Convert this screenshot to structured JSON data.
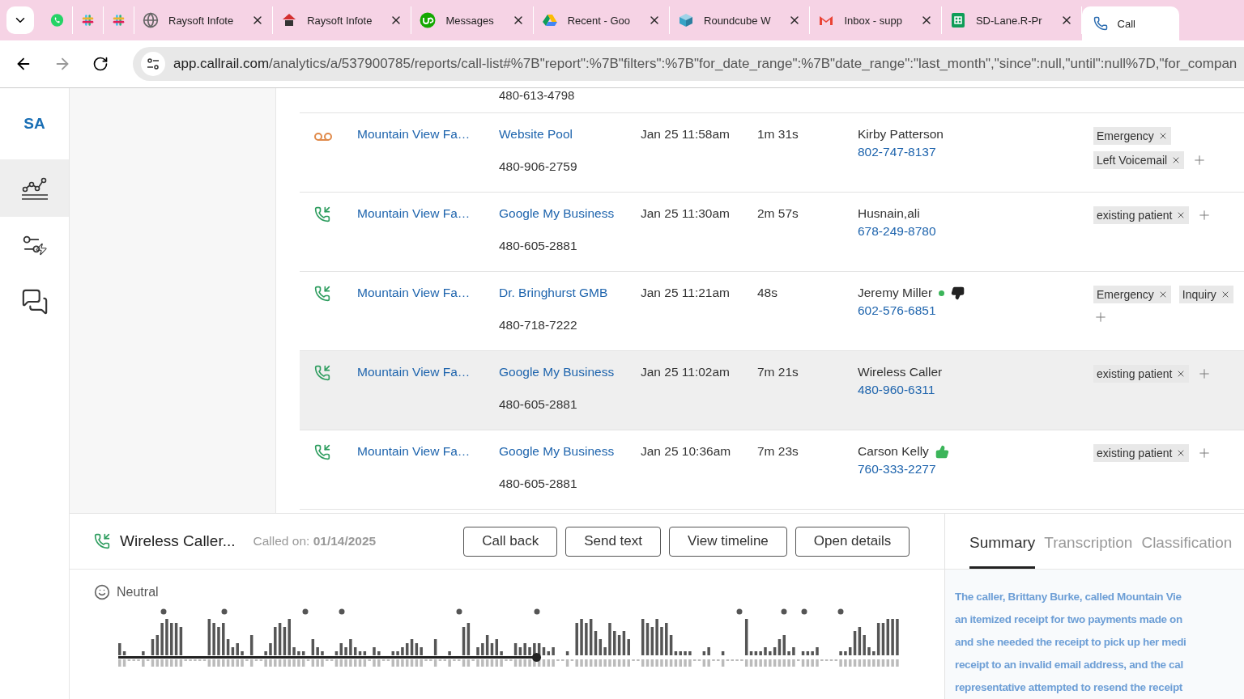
{
  "browser": {
    "tabs": [
      {
        "kind": "whatsapp",
        "selected": false
      },
      {
        "kind": "slack",
        "selected": false
      },
      {
        "kind": "slack",
        "selected": false
      },
      {
        "kind": "globe",
        "title": "Raysoft Infote",
        "selected": false
      },
      {
        "kind": "raysoft",
        "title": "Raysoft Infote",
        "selected": false
      },
      {
        "kind": "upwork",
        "title": "Messages",
        "selected": false
      },
      {
        "kind": "drive",
        "title": "Recent - Goo",
        "selected": false
      },
      {
        "kind": "roundcube",
        "title": "Roundcube W",
        "selected": false
      },
      {
        "kind": "gmail",
        "title": "Inbox - supp",
        "selected": false
      },
      {
        "kind": "sheets",
        "title": "SD-Lane.R-Pr",
        "selected": false
      },
      {
        "kind": "phone",
        "title": "Call",
        "selected": true
      }
    ],
    "url_domain": "app.callrail.com",
    "url_path": "/analytics/a/537900785/reports/call-list#%7B\"report\":%7B\"filters\":%7B\"for_date_range\":%7B\"date_range\":\"last_month\",\"since\":null,\"until\":null%7D,\"for_compan"
  },
  "sidebar": {
    "avatar": "SA",
    "items": [
      {
        "kind": "analytics",
        "selected": true
      },
      {
        "kind": "settings",
        "selected": false
      },
      {
        "kind": "messages",
        "selected": false
      }
    ]
  },
  "partial_row": {
    "number": "480-613-4798"
  },
  "rows": [
    {
      "kind": "voicemail",
      "company": "Mountain View Fa…",
      "source": "Website Pool",
      "number": "480-906-2759",
      "date": "Jan 25 11:58am",
      "duration": "1m 31s",
      "caller": "Kirby Patterson",
      "caller_phone": "802-747-8137",
      "dot": false,
      "thumbs_up": false,
      "thumbs_down": false,
      "selected": false,
      "tags": [
        "Emergency",
        "Left Voicemail"
      ]
    },
    {
      "kind": "inbound",
      "company": "Mountain View Fa…",
      "source": "Google My Business",
      "number": "480-605-2881",
      "date": "Jan 25 11:30am",
      "duration": "2m 57s",
      "caller": "Husnain,ali",
      "caller_phone": "678-249-8780",
      "dot": false,
      "thumbs_up": false,
      "thumbs_down": false,
      "selected": false,
      "tags": [
        "existing patient"
      ]
    },
    {
      "kind": "inbound",
      "company": "Mountain View Fa…",
      "source": "Dr. Bringhurst GMB",
      "number": "480-718-7222",
      "date": "Jan 25 11:21am",
      "duration": "48s",
      "caller": "Jeremy Miller",
      "caller_phone": "602-576-6851",
      "dot": true,
      "thumbs_up": false,
      "thumbs_down": true,
      "selected": false,
      "tags": [
        "Emergency",
        "Inquiry"
      ]
    },
    {
      "kind": "inbound",
      "company": "Mountain View Fa…",
      "source": "Google My Business",
      "number": "480-605-2881",
      "date": "Jan 25 11:02am",
      "duration": "7m 21s",
      "caller": "Wireless Caller",
      "caller_phone": "480-960-6311",
      "dot": false,
      "thumbs_up": false,
      "thumbs_down": false,
      "selected": true,
      "tags": [
        "existing patient"
      ]
    },
    {
      "kind": "inbound",
      "company": "Mountain View Fa…",
      "source": "Google My Business",
      "number": "480-605-2881",
      "date": "Jan 25 10:36am",
      "duration": "7m 23s",
      "caller": "Carson Kelly",
      "caller_phone": "760-333-2277",
      "dot": false,
      "thumbs_up": true,
      "thumbs_down": false,
      "selected": false,
      "tags": [
        "existing patient"
      ]
    }
  ],
  "detail": {
    "caller": "Wireless Caller...",
    "called_on_label": "Called on:",
    "called_on": "01/14/2025",
    "buttons": [
      "Call back",
      "Send text",
      "View timeline",
      "Open details"
    ],
    "sentiment": "Neutral",
    "playback": {
      "level": 0.535
    },
    "tabs": [
      {
        "label": "Summary",
        "selected": true
      },
      {
        "label": "Transcription",
        "selected": false
      },
      {
        "label": "Classification",
        "selected": false
      }
    ],
    "summary_lines": [
      "The caller, Brittany Burke, called Mountain Vie",
      "an itemized receipt for two payments made on",
      "and she needed the receipt to pick up her medi",
      "receipt to an invalid email address, and the cal",
      "representative attempted to resend the receipt"
    ]
  }
}
